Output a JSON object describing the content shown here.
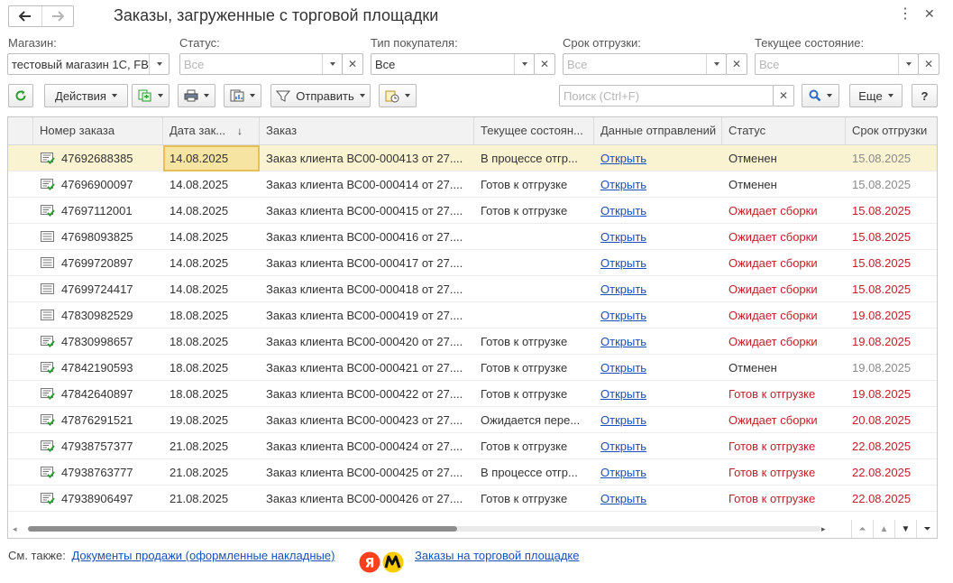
{
  "window": {
    "title": "Заказы, загруженные с торговой площадки"
  },
  "filters": {
    "store": {
      "label": "Магазин:",
      "value": "тестовый магазин 1С, FB"
    },
    "status": {
      "label": "Статус:",
      "placeholder": "Все"
    },
    "buyer_type": {
      "label": "Тип покупателя:",
      "value": "Все"
    },
    "ship_date": {
      "label": "Срок отгрузки:",
      "placeholder": "Все"
    },
    "current_state": {
      "label": "Текущее состояние:",
      "placeholder": "Все"
    }
  },
  "toolbar": {
    "actions": "Действия",
    "send": "Отправить",
    "search_placeholder": "Поиск (Ctrl+F)",
    "more": "Еще",
    "help": "?"
  },
  "table": {
    "columns": [
      "Номер заказа",
      "Дата зак...",
      "Заказ",
      "Текущее состоян...",
      "Данные отправлений",
      "Статус",
      "Срок отгрузки"
    ],
    "rows": [
      {
        "num": "47692688385",
        "date": "14.08.2025",
        "order": "Заказ клиента ВС00-000413 от 27....",
        "state": "В процессе отгр...",
        "link": "Открыть",
        "status": "Отменен",
        "status_color": "normal",
        "ship": "15.08.2025",
        "ship_color": "gray",
        "icon": "check"
      },
      {
        "num": "47696900097",
        "date": "14.08.2025",
        "order": "Заказ клиента ВС00-000414 от 27....",
        "state": "Готов к отгрузке",
        "link": "Открыть",
        "status": "Отменен",
        "status_color": "normal",
        "ship": "15.08.2025",
        "ship_color": "gray",
        "icon": "check"
      },
      {
        "num": "47697112001",
        "date": "14.08.2025",
        "order": "Заказ клиента ВС00-000415 от 27....",
        "state": "Готов к отгрузке",
        "link": "Открыть",
        "status": "Ожидает сборки",
        "status_color": "red",
        "ship": "15.08.2025",
        "ship_color": "red",
        "icon": "check"
      },
      {
        "num": "47698093825",
        "date": "14.08.2025",
        "order": "Заказ клиента ВС00-000416 от 27....",
        "state": "",
        "link": "Открыть",
        "status": "Ожидает сборки",
        "status_color": "red",
        "ship": "15.08.2025",
        "ship_color": "red",
        "icon": "plain"
      },
      {
        "num": "47699720897",
        "date": "14.08.2025",
        "order": "Заказ клиента ВС00-000417 от 27....",
        "state": "",
        "link": "Открыть",
        "status": "Ожидает сборки",
        "status_color": "red",
        "ship": "15.08.2025",
        "ship_color": "red",
        "icon": "plain"
      },
      {
        "num": "47699724417",
        "date": "14.08.2025",
        "order": "Заказ клиента ВС00-000418 от 27....",
        "state": "",
        "link": "Открыть",
        "status": "Ожидает сборки",
        "status_color": "red",
        "ship": "15.08.2025",
        "ship_color": "red",
        "icon": "plain"
      },
      {
        "num": "47830982529",
        "date": "18.08.2025",
        "order": "Заказ клиента ВС00-000419 от 27....",
        "state": "",
        "link": "Открыть",
        "status": "Ожидает сборки",
        "status_color": "red",
        "ship": "19.08.2025",
        "ship_color": "red",
        "icon": "plain"
      },
      {
        "num": "47830998657",
        "date": "18.08.2025",
        "order": "Заказ клиента ВС00-000420 от 27....",
        "state": "Готов к отгрузке",
        "link": "Открыть",
        "status": "Ожидает сборки",
        "status_color": "red",
        "ship": "19.08.2025",
        "ship_color": "red",
        "icon": "check"
      },
      {
        "num": "47842190593",
        "date": "18.08.2025",
        "order": "Заказ клиента ВС00-000421 от 27....",
        "state": "Готов к отгрузке",
        "link": "Открыть",
        "status": "Отменен",
        "status_color": "normal",
        "ship": "19.08.2025",
        "ship_color": "gray",
        "icon": "check"
      },
      {
        "num": "47842640897",
        "date": "18.08.2025",
        "order": "Заказ клиента ВС00-000422 от 27....",
        "state": "Готов к отгрузке",
        "link": "Открыть",
        "status": "Готов к отгрузке",
        "status_color": "red",
        "ship": "19.08.2025",
        "ship_color": "red",
        "icon": "check"
      },
      {
        "num": "47876291521",
        "date": "19.08.2025",
        "order": "Заказ клиента ВС00-000423 от 27....",
        "state": "Ожидается пере...",
        "link": "Открыть",
        "status": "Ожидает сборки",
        "status_color": "red",
        "ship": "20.08.2025",
        "ship_color": "red",
        "icon": "check"
      },
      {
        "num": "47938757377",
        "date": "21.08.2025",
        "order": "Заказ клиента ВС00-000424 от 27....",
        "state": "Готов к отгрузке",
        "link": "Открыть",
        "status": "Готов к отгрузке",
        "status_color": "red",
        "ship": "22.08.2025",
        "ship_color": "red",
        "icon": "check"
      },
      {
        "num": "47938763777",
        "date": "21.08.2025",
        "order": "Заказ клиента ВС00-000425 от 27....",
        "state": "В процессе отгр...",
        "link": "Открыть",
        "status": "Готов к отгрузке",
        "status_color": "red",
        "ship": "22.08.2025",
        "ship_color": "red",
        "icon": "check"
      },
      {
        "num": "47938906497",
        "date": "21.08.2025",
        "order": "Заказ клиента ВС00-000426 от 27....",
        "state": "Готов к отгрузке",
        "link": "Открыть",
        "status": "Готов к отгрузке",
        "status_color": "red",
        "ship": "22.08.2025",
        "ship_color": "red",
        "icon": "check"
      }
    ]
  },
  "footer": {
    "see_also": "См. также:",
    "link1": "Документы продажи (оформленные накладные)",
    "link2": "Заказы на торговой площадке",
    "logo_text": "Я"
  },
  "colors": {
    "red": "#c0202a",
    "gray": "#8a8a8a",
    "link": "#1a50b7",
    "selected_row": "#faf3d2",
    "green_check": "#2e9a35"
  }
}
